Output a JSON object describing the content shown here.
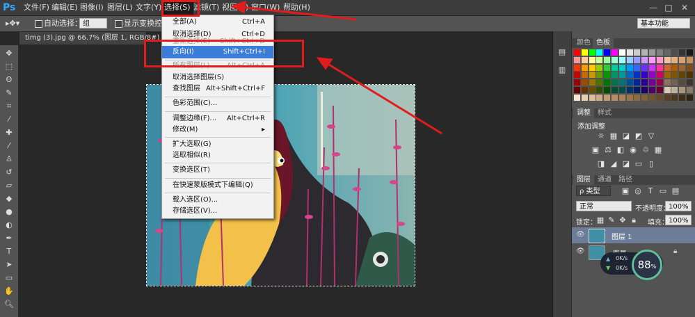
{
  "app": {
    "logo": "Ps"
  },
  "menubar": {
    "items": [
      "文件(F)",
      "编辑(E)",
      "图像(I)",
      "图层(L)",
      "文字(Y)",
      "选择(S)",
      "滤镜(T)",
      "视图(V)",
      "窗口(W)",
      "帮助(H)"
    ],
    "window_controls": [
      "—",
      "□",
      "✕"
    ]
  },
  "options_bar": {
    "auto_select_label": "自动选择：",
    "auto_select_value": "组",
    "show_transform_label": "显示变换控件",
    "workspace": "基本功能"
  },
  "document_tab": {
    "title": "timg (3).jpg @ 66.7% (图层 1, RGB/8#) *",
    "close": "×"
  },
  "select_menu": {
    "items": [
      {
        "label": "全部(A)",
        "shortcut": "Ctrl+A",
        "state": "normal"
      },
      {
        "label": "取消选择(D)",
        "shortcut": "Ctrl+D",
        "state": "normal"
      },
      {
        "label": "重新选择(E)",
        "shortcut": "Shift+Ctrl+D",
        "state": "disabled"
      },
      {
        "label": "反向(I)",
        "shortcut": "Shift+Ctrl+I",
        "state": "highlighted"
      },
      {
        "label": "所有图层(L)",
        "shortcut": "Alt+Ctrl+A",
        "state": "normal"
      },
      {
        "label": "取消选择图层(S)",
        "shortcut": "",
        "state": "normal"
      },
      {
        "label": "查找图层",
        "shortcut": "Alt+Shift+Ctrl+F",
        "state": "normal"
      },
      {
        "label": "色彩范围(C)...",
        "shortcut": "",
        "state": "normal"
      },
      {
        "label": "调整边缘(F)...",
        "shortcut": "Alt+Ctrl+R",
        "state": "normal"
      },
      {
        "label": "修改(M)",
        "shortcut": "▸",
        "state": "normal"
      },
      {
        "label": "扩大选取(G)",
        "shortcut": "",
        "state": "normal"
      },
      {
        "label": "选取相似(R)",
        "shortcut": "",
        "state": "normal"
      },
      {
        "label": "变换选区(T)",
        "shortcut": "",
        "state": "normal"
      },
      {
        "label": "在快速蒙版模式下编辑(Q)",
        "shortcut": "",
        "state": "normal"
      },
      {
        "label": "载入选区(O)...",
        "shortcut": "",
        "state": "normal"
      },
      {
        "label": "存储选区(V)...",
        "shortcut": "",
        "state": "normal"
      }
    ]
  },
  "swatches_panel": {
    "tabs": [
      "颜色",
      "色板"
    ]
  },
  "adjustments_panel": {
    "tabs": [
      "调整",
      "样式"
    ],
    "title": "添加调整"
  },
  "layers_panel": {
    "tabs": [
      "图层",
      "通道",
      "路径"
    ],
    "filter_label": "ρ 类型",
    "blend_mode": "正常",
    "opacity_label": "不透明度：",
    "opacity_value": "100%",
    "lock_label": "锁定：",
    "fill_label": "填充：",
    "fill_value": "100%",
    "layers": [
      {
        "name": "图层 1",
        "selected": true
      },
      {
        "name": "背景",
        "selected": false
      }
    ]
  },
  "net_widget": {
    "up": "0K/s",
    "down": "0K/s",
    "percent": "88",
    "percent_unit": "%"
  },
  "colors": {
    "menu_highlight": "#3a7cd8",
    "annotation_red": "#e21c1c",
    "ps_blue": "#31a8ff"
  }
}
